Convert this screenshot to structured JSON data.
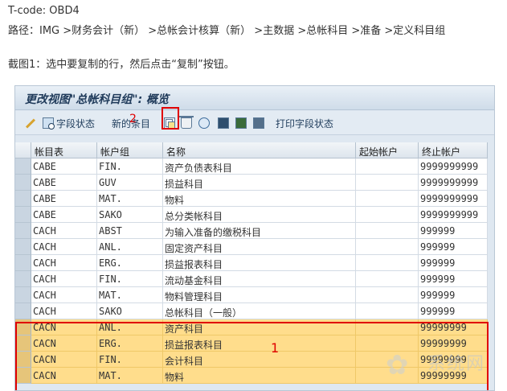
{
  "header": {
    "tcode": "T-code: OBD4",
    "path": "路径：IMG >财务会计（新） >总帐会计核算（新） >主数据 >总帐科目 >准备 >定义科目组",
    "caption": "截图1：选中要复制的行，然后点击“复制”按钮。"
  },
  "window": {
    "title": "更改视图\"总帐科目组\": 概览"
  },
  "toolbar": {
    "field_status_label": "字段状态",
    "new_entries_label": "新的条目",
    "print_field_status_label": "打印字段状态"
  },
  "annotations": {
    "step1": "1",
    "step2": "2"
  },
  "table": {
    "columns": [
      "帐目表",
      "帐户组",
      "名称",
      "起始帐户",
      "终止帐户"
    ],
    "rows": [
      {
        "chart": "CABE",
        "group": "FIN.",
        "name": "资产负债表科目",
        "from": "",
        "to": "9999999999",
        "highlight": false
      },
      {
        "chart": "CABE",
        "group": "GUV",
        "name": "损益科目",
        "from": "",
        "to": "9999999999",
        "highlight": false
      },
      {
        "chart": "CABE",
        "group": "MAT.",
        "name": "物料",
        "from": "",
        "to": "9999999999",
        "highlight": false
      },
      {
        "chart": "CABE",
        "group": "SAKO",
        "name": "总分类帐科目",
        "from": "",
        "to": "9999999999",
        "highlight": false
      },
      {
        "chart": "CACH",
        "group": "ABST",
        "name": "为输入准备的缴税科目",
        "from": "",
        "to": "999999",
        "highlight": false
      },
      {
        "chart": "CACH",
        "group": "ANL.",
        "name": "固定资产科目",
        "from": "",
        "to": "999999",
        "highlight": false
      },
      {
        "chart": "CACH",
        "group": "ERG.",
        "name": "损益报表科目",
        "from": "",
        "to": "999999",
        "highlight": false
      },
      {
        "chart": "CACH",
        "group": "FIN.",
        "name": "流动基金科目",
        "from": "",
        "to": "999999",
        "highlight": false
      },
      {
        "chart": "CACH",
        "group": "MAT.",
        "name": "物料管理科目",
        "from": "",
        "to": "999999",
        "highlight": false
      },
      {
        "chart": "CACH",
        "group": "SAKO",
        "name": "总帐科目（一般）",
        "from": "",
        "to": "999999",
        "highlight": false
      },
      {
        "chart": "CACN",
        "group": "ANL.",
        "name": "资产科目",
        "from": "",
        "to": "99999999",
        "highlight": true
      },
      {
        "chart": "CACN",
        "group": "ERG.",
        "name": "损益报表科目",
        "from": "",
        "to": "99999999",
        "highlight": true
      },
      {
        "chart": "CACN",
        "group": "FIN.",
        "name": "会计科目",
        "from": "",
        "to": "99999999",
        "highlight": true
      },
      {
        "chart": "CACN",
        "group": "MAT.",
        "name": "物料",
        "from": "",
        "to": "99999999",
        "highlight": true
      }
    ]
  },
  "watermark": {
    "text": "系统网"
  },
  "colors": {
    "highlight_row": "#ffdd8c",
    "annotation_red": "#e00000",
    "sap_frame": "#dfe8f1"
  }
}
